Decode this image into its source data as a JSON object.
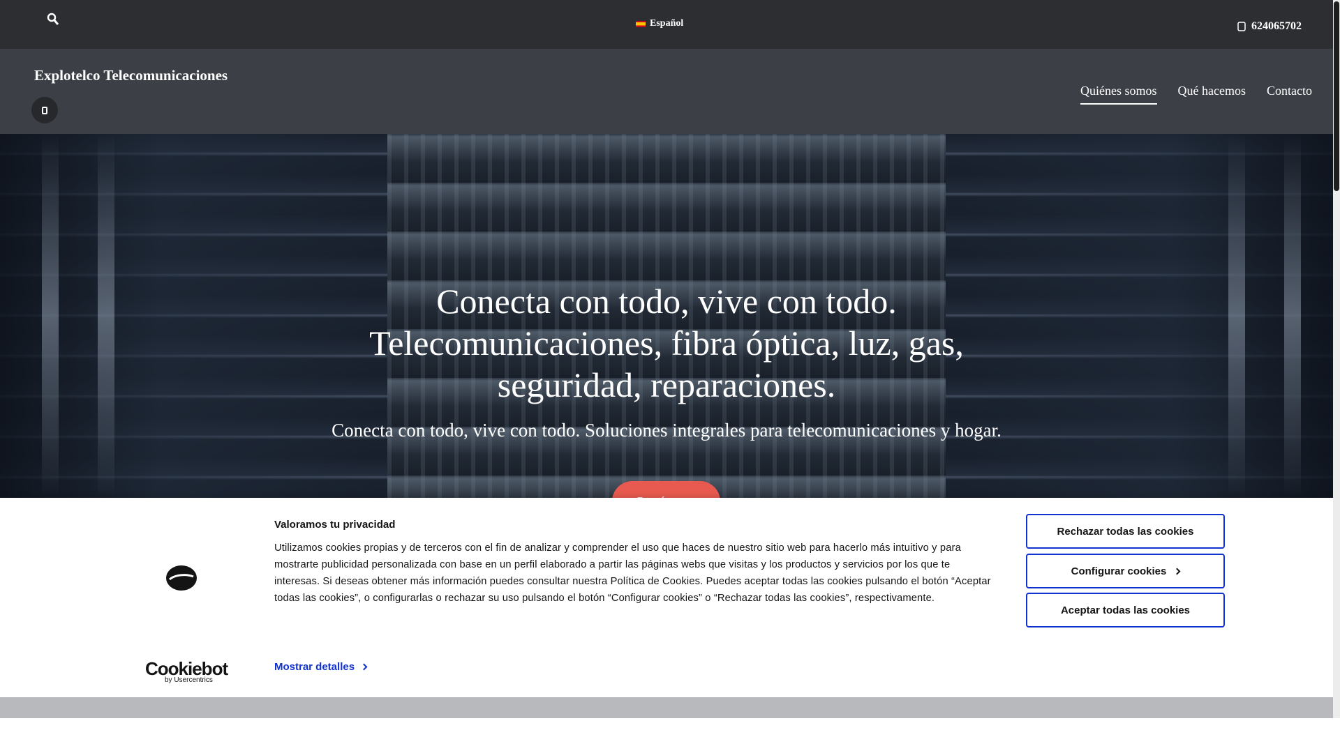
{
  "topbar": {
    "language": "Español",
    "phone": "624065702"
  },
  "header": {
    "brand": "Explotelco Telecomunicaciones",
    "nav": [
      {
        "label": "Quiénes somos",
        "active": true
      },
      {
        "label": "Qué hacemos",
        "active": false
      },
      {
        "label": "Contacto",
        "active": false
      }
    ]
  },
  "hero": {
    "title": "Conecta con todo, vive con todo. Telecomunicaciones, fibra óptica, luz, gas, seguridad, reparaciones.",
    "subtitle": "Conecta con todo, vive con todo. Soluciones integrales para telecomunicaciones y hogar.",
    "cta": "Contáctanos"
  },
  "cookie": {
    "title": "Valoramos tu privacidad",
    "text": "Utilizamos cookies propias y de terceros con el fin de analizar y comprender el uso que haces de nuestro sitio web para hacerlo más intuitivo y para mostrarte publicidad personalizada con base en un perfil elaborado a partir las páginas webs que visitas y los productos y servicios por los que te interesas. Si deseas obtener más información puedes consultar nuestra Política de Cookies. Puedes aceptar todas las cookies pulsando el botón “Aceptar todas las cookies”, o configurarlas o rechazar su uso pulsando el botón “Configurar cookies” o “Rechazar todas las cookies”, respectivamente.",
    "details_link": "Mostrar detalles",
    "reject_all": "Rechazar todas las cookies",
    "configure": "Configurar cookies",
    "accept_all": "Aceptar todas las cookies",
    "brand_name": "Cookiebot",
    "brand_sub": "by Usercentrics"
  },
  "colors": {
    "topbar": "#2c2e32",
    "header": "#3c3f45",
    "cta": "#e85a4f",
    "cookie_accent": "#1032cf"
  }
}
